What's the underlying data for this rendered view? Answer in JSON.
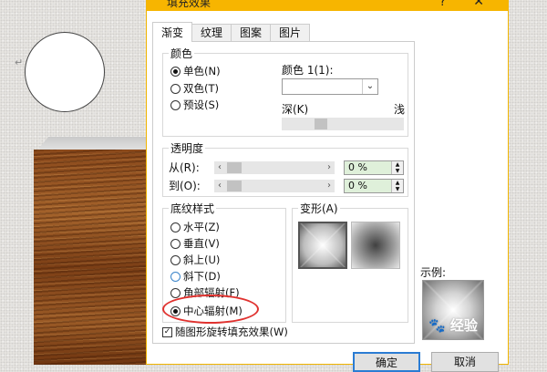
{
  "dialog": {
    "title": "填充效果",
    "help_glyph": "?",
    "close_glyph": "✕"
  },
  "tabs": [
    {
      "label": "渐变",
      "active": true
    },
    {
      "label": "纹理",
      "active": false
    },
    {
      "label": "图案",
      "active": false
    },
    {
      "label": "图片",
      "active": false
    }
  ],
  "colors": {
    "group_label": "颜色",
    "options": [
      {
        "label": "单色(N)",
        "checked": true
      },
      {
        "label": "双色(T)",
        "checked": false
      },
      {
        "label": "预设(S)",
        "checked": false
      }
    ],
    "color1_label": "颜色 1(1):",
    "dropdown_arrow": "⌄",
    "dark_label": "深(K)",
    "light_label": "浅"
  },
  "transparency": {
    "group_label": "透明度",
    "from_label": "从(R):",
    "to_label": "到(O):",
    "from_value": "0 %",
    "to_value": "0 %"
  },
  "shading": {
    "group_label": "底纹样式",
    "options": [
      {
        "label": "水平(Z)",
        "checked": false
      },
      {
        "label": "垂直(V)",
        "checked": false
      },
      {
        "label": "斜上(U)",
        "checked": false
      },
      {
        "label": "斜下(D)",
        "checked": false
      },
      {
        "label": "角部辐射(F)",
        "checked": false
      },
      {
        "label": "中心辐射(M)",
        "checked": true
      }
    ]
  },
  "variants": {
    "group_label": "变形(A)"
  },
  "sample": {
    "label": "示例:"
  },
  "rotate_with_shape": {
    "label": "随图形旋转填充效果(W)",
    "checked": true,
    "check_glyph": "✓"
  },
  "buttons": {
    "ok": "确定",
    "cancel": "取消"
  },
  "document": {
    "paragraph_mark": "↵"
  },
  "watermark": "🐾 经验"
}
